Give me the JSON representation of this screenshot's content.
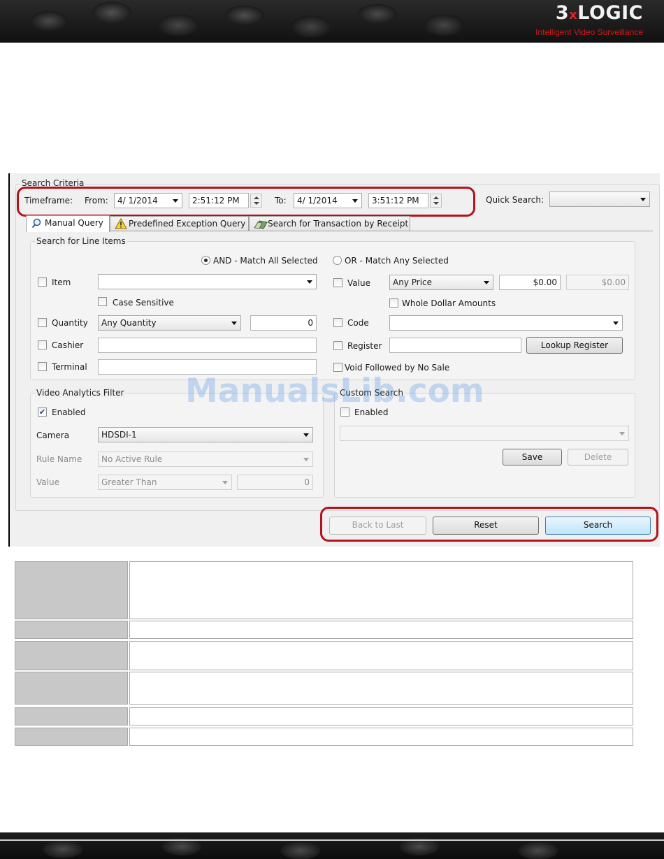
{
  "header": {
    "logo_pre": "3",
    "logo_x": "x",
    "logo_post": "LOGIC",
    "tagline": "Intelligent Video Surveillance"
  },
  "search_criteria": {
    "title": "Search Criteria",
    "timeframe_label": "Timeframe:",
    "from_label": "From:",
    "from_date": "4/  1/2014",
    "from_time": "2:51:12 PM",
    "to_label": "To:",
    "to_date": "4/  1/2014",
    "to_time": "3:51:12 PM",
    "quick_search_label": "Quick Search:",
    "quick_search_value": ""
  },
  "tabs": [
    {
      "label": "Manual Query",
      "icon": "search-icon",
      "active": true
    },
    {
      "label": "Predefined Exception Query",
      "icon": "warning-icon",
      "active": false
    },
    {
      "label": "Search for Transaction by Receipt",
      "icon": "receipt-icon",
      "active": false
    }
  ],
  "line_items": {
    "title": "Search for Line Items",
    "and_label": "AND - Match All Selected",
    "or_label": "OR - Match Any Selected",
    "item_label": "Item",
    "item_value": "",
    "case_sensitive_label": "Case Sensitive",
    "quantity_label": "Quantity",
    "quantity_combo": "Any Quantity",
    "quantity_value": "0",
    "cashier_label": "Cashier",
    "cashier_value": "",
    "terminal_label": "Terminal",
    "terminal_value": "",
    "value_label": "Value",
    "value_combo": "Any Price",
    "value_min": "$0.00",
    "value_max": "$0.00",
    "whole_dollar_label": "Whole Dollar Amounts",
    "code_label": "Code",
    "code_value": "",
    "register_label": "Register",
    "register_value": "",
    "lookup_register_label": "Lookup Register",
    "void_label": "Void Followed by No Sale"
  },
  "video_analytics": {
    "title": "Video Analytics Filter",
    "enabled_label": "Enabled",
    "enabled": true,
    "camera_label": "Camera",
    "camera_value": "HDSDI-1",
    "rule_label": "Rule Name",
    "rule_value": "No Active Rule",
    "value_label": "Value",
    "comparator_value": "Greater Than",
    "threshold_value": "0"
  },
  "custom_search": {
    "title": "Custom Search",
    "enabled_label": "Enabled",
    "enabled": false,
    "selection": "",
    "save_label": "Save",
    "delete_label": "Delete"
  },
  "actions": {
    "back_label": "Back to Last",
    "reset_label": "Reset",
    "search_label": "Search"
  },
  "watermark": "ManualsLib.com",
  "colors": {
    "highlight": "#b3141c",
    "logo_accent": "#d01818",
    "table_label_bg": "#c8c8c8"
  }
}
